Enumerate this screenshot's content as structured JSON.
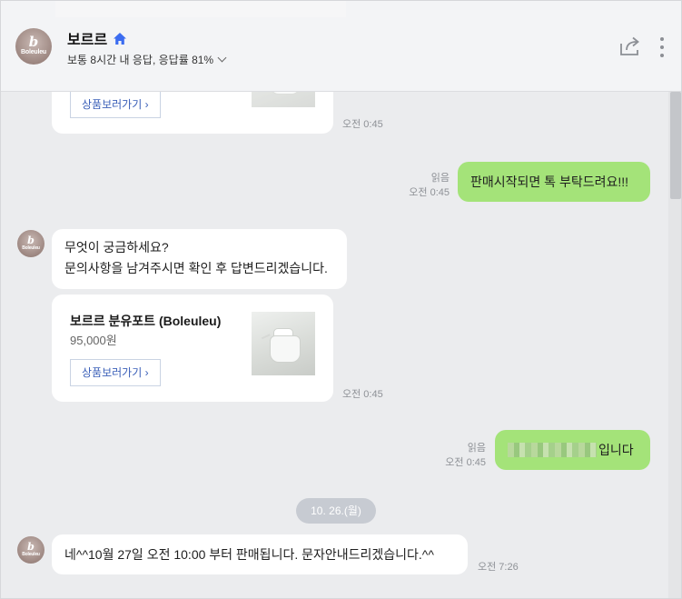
{
  "header": {
    "name": "보르르",
    "response_info": "보통 8시간 내 응답, 응답률 81%"
  },
  "messages": {
    "card_top": {
      "link": "상품보러가기",
      "time": "오전 0:45"
    },
    "mine1": {
      "text": "판매시작되면 톡 부탁드려요!!!",
      "read": "읽음",
      "time": "오전 0:45"
    },
    "reply1": {
      "text": "무엇이 궁금하세요?\n문의사항을 남겨주시면 확인 후 답변드리겠습니다."
    },
    "card2": {
      "name": "보르르 분유포트 (Boleuleu)",
      "price": "95,000원",
      "link": "상품보러가기",
      "time": "오전 0:45"
    },
    "mine2": {
      "text_suffix": "입니다",
      "read": "읽음",
      "time": "오전 0:45"
    },
    "date_divider": "10. 26.(월)",
    "reply2": {
      "text": "네^^10월 27일 오전 10:00 부터 판매됩니다. 문자안내드리겠습니다.^^",
      "time": "오전 7:26"
    }
  },
  "avatar": {
    "text_b": "b",
    "text_word": "Boleuleu"
  },
  "colors": {
    "my_bubble": "#a4e379",
    "accent": "#3a5fb8",
    "home_icon": "#3b6cf0"
  }
}
